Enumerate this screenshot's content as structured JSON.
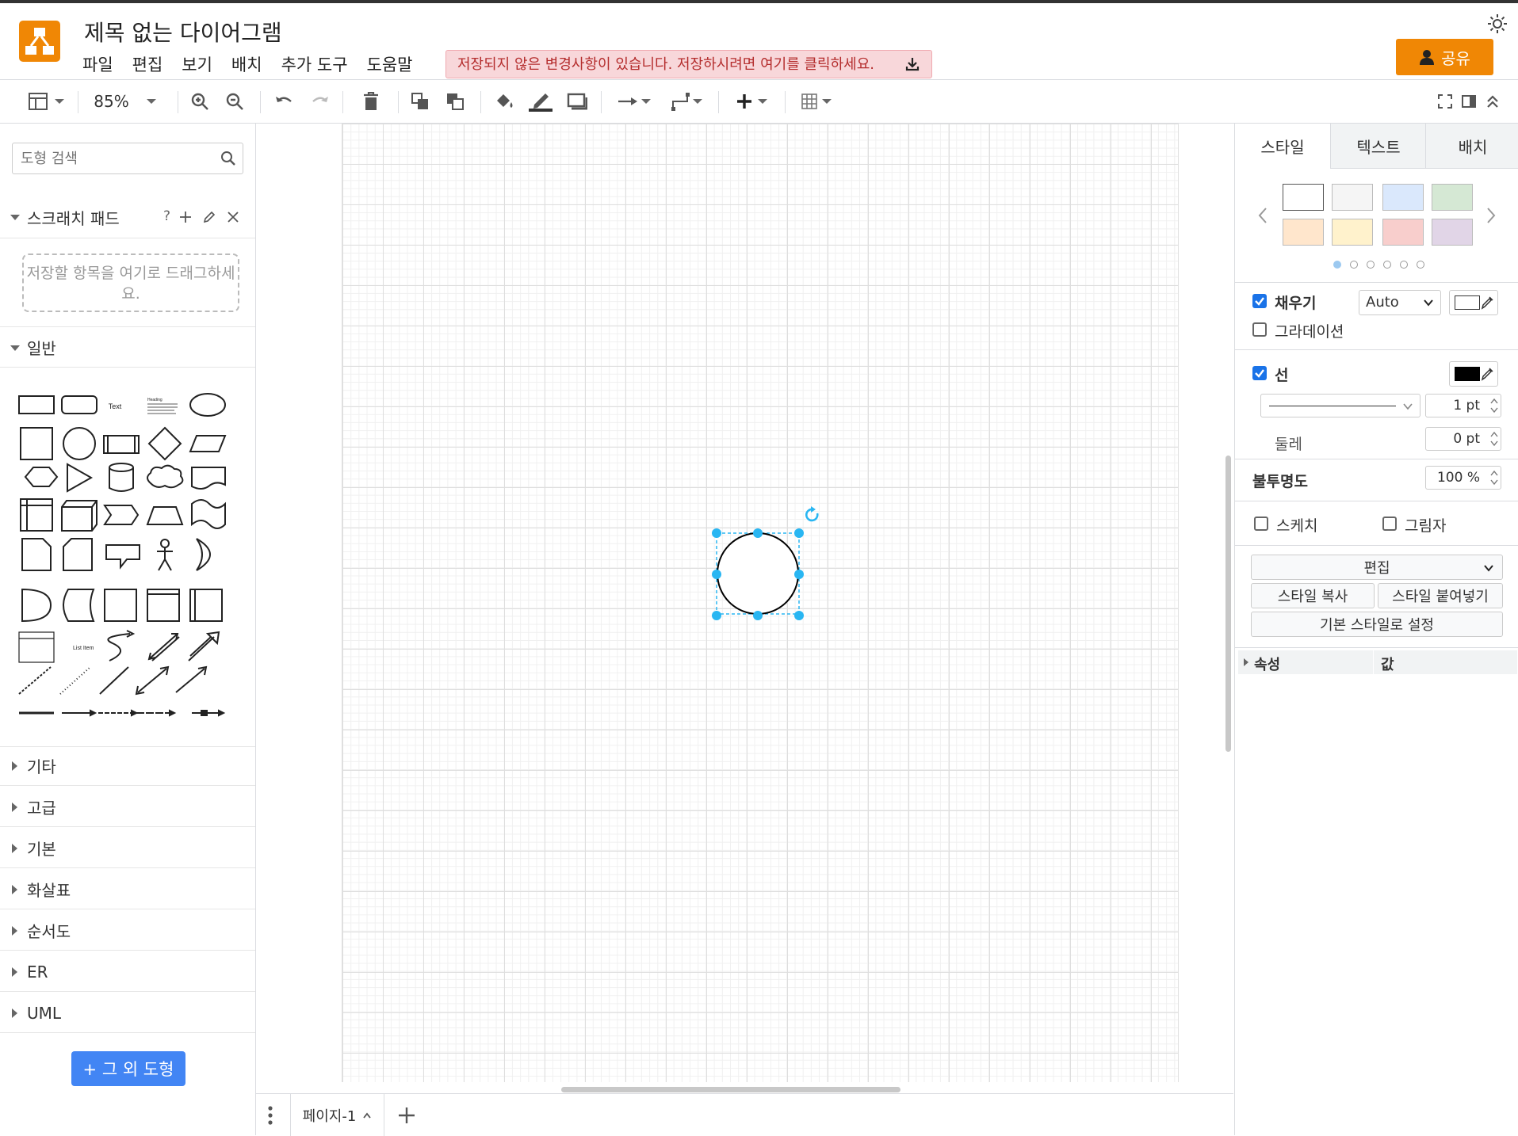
{
  "app": {
    "title": "제목 없는 다이어그램",
    "menu": [
      "파일",
      "편집",
      "보기",
      "배치",
      "추가 도구",
      "도움말"
    ],
    "unsaved_notice": "저장되지 않은 변경사항이 있습니다. 저장하시려면 여기를 클릭하세요.",
    "share_label": "공유",
    "accent_color": "#f08705"
  },
  "toolbar": {
    "zoom": "85%",
    "icons": [
      "format-panel-icon",
      "zoom-in-icon",
      "zoom-out-icon",
      "undo-icon",
      "redo-icon",
      "delete-icon",
      "to-front-icon",
      "to-back-icon",
      "fill-color-icon",
      "line-color-icon",
      "shadow-icon",
      "connection-icon",
      "waypoints-icon",
      "insert-icon",
      "table-icon",
      "fullscreen-icon",
      "toggle-panel-icon",
      "collapse-icon"
    ]
  },
  "sidebar": {
    "search_placeholder": "도형 검색",
    "scratchpad": {
      "title": "스크래치 패드",
      "help": "?",
      "drop_hint": "저장할 항목을 여기로 드래그하세요."
    },
    "general_title": "일반",
    "shape_labels": {
      "text": "Text",
      "heading": "Heading",
      "list_item": "List Item"
    },
    "sections": [
      "기타",
      "고급",
      "기본",
      "화살표",
      "순서도",
      "ER",
      "UML"
    ],
    "more_shapes": "+ 그 외 도형"
  },
  "bottom": {
    "page_tab": "페이지-1"
  },
  "format_panel": {
    "tabs": [
      "스타일",
      "텍스트",
      "배치"
    ],
    "swatches": [
      "#ffffff",
      "#f5f5f5",
      "#dae8fc",
      "#d5e8d4",
      "#ffe6cc",
      "#fff2cc",
      "#f8cecc",
      "#e1d5e7"
    ],
    "fill": {
      "label": "채우기",
      "checked": true,
      "mode": "Auto"
    },
    "gradient": {
      "label": "그라데이션",
      "checked": false
    },
    "line": {
      "label": "선",
      "checked": true,
      "color": "#000000",
      "width": "1 pt"
    },
    "perimeter": {
      "label": "둘레",
      "value": "0 pt"
    },
    "opacity": {
      "label": "불투명도",
      "value": "100 %"
    },
    "sketch": {
      "label": "스케치",
      "checked": false
    },
    "shadow": {
      "label": "그림자",
      "checked": false
    },
    "edit_label": "편집",
    "copy_style": "스타일 복사",
    "paste_style": "스타일 붙여넣기",
    "set_default": "기본 스타일로 설정",
    "property_col": "속성",
    "value_col": "값"
  },
  "selection_color": "#29b6f2"
}
